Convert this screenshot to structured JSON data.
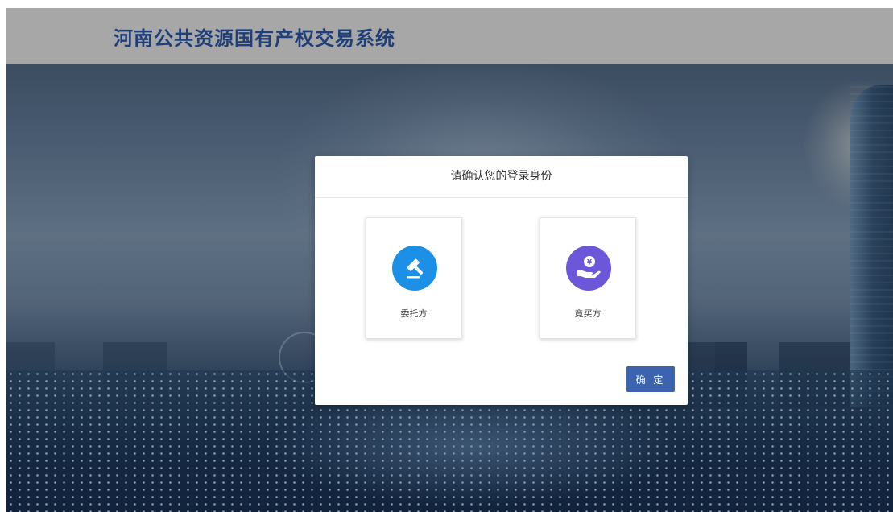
{
  "header": {
    "title": "河南公共资源国有产权交易系统"
  },
  "dialog": {
    "title": "请确认您的登录身份",
    "roles": [
      {
        "label": "委托方",
        "icon": "gavel-icon",
        "color": "#1c90e6"
      },
      {
        "label": "竟买方",
        "icon": "hand-coin-icon",
        "color": "#6b57d8"
      }
    ],
    "confirm_label": "确 定"
  },
  "colors": {
    "header_bg": "#a7a7a7",
    "title_text": "#1f3f7a",
    "confirm_button": "#3c63ae"
  }
}
